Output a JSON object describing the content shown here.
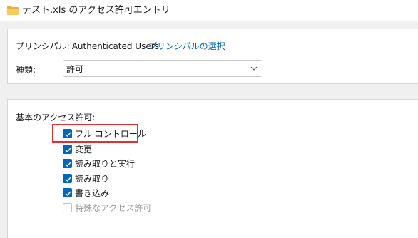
{
  "window": {
    "title": "テスト.xls のアクセス許可エントリ",
    "icon": "folder-icon"
  },
  "principal": {
    "label": "プリンシパル:",
    "value": "Authenticated Users",
    "select_link": "プリンシパルの選択"
  },
  "type": {
    "label": "種類:",
    "selected": "許可",
    "icon": "chevron-down-icon"
  },
  "permissions": {
    "heading": "基本のアクセス許可:",
    "items": [
      {
        "label": "フル コントロール",
        "checked": true,
        "enabled": true,
        "highlighted": true
      },
      {
        "label": "変更",
        "checked": true,
        "enabled": true
      },
      {
        "label": "読み取りと実行",
        "checked": true,
        "enabled": true
      },
      {
        "label": "読み取り",
        "checked": true,
        "enabled": true
      },
      {
        "label": "書き込み",
        "checked": true,
        "enabled": true
      },
      {
        "label": "特殊なアクセス許可",
        "checked": false,
        "enabled": false
      }
    ]
  },
  "colors": {
    "accent": "#0067c0",
    "link": "#0066cc",
    "highlight": "#e0312f",
    "folder": "#f5c242"
  }
}
